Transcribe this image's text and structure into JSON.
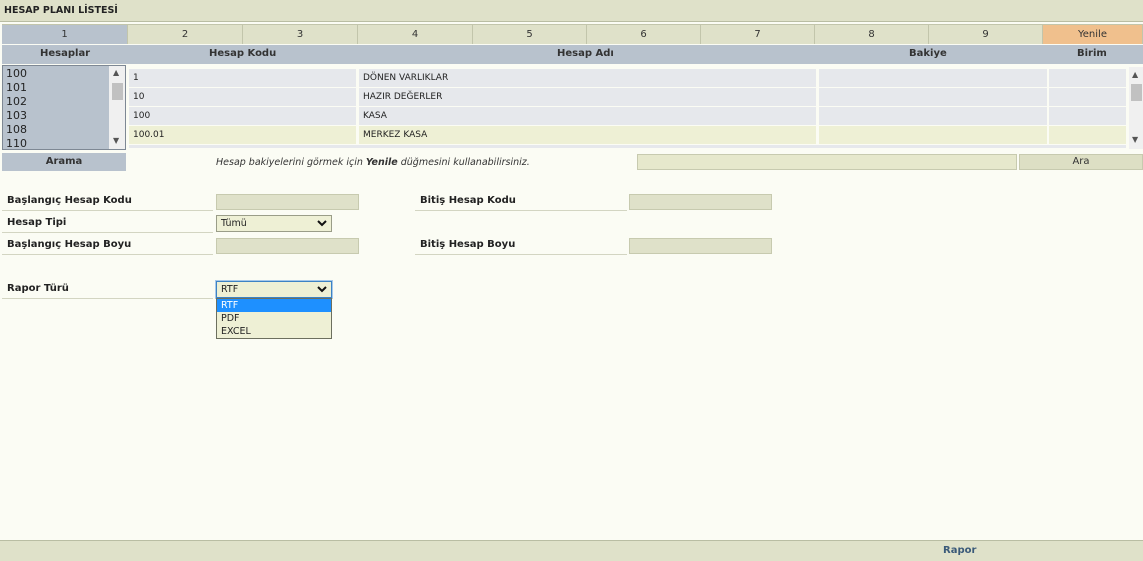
{
  "page": {
    "title": "HESAP PLANI LİSTESİ"
  },
  "tabs": [
    "1",
    "2",
    "3",
    "4",
    "5",
    "6",
    "7",
    "8",
    "9",
    "Yenile"
  ],
  "columns": {
    "hesaplar": "Hesaplar",
    "hesap_kodu": "Hesap Kodu",
    "hesap_adi": "Hesap Adı",
    "bakiye": "Bakiye",
    "birim": "Birim"
  },
  "account_list": [
    "100",
    "101",
    "102",
    "103",
    "108",
    "110"
  ],
  "rows": [
    {
      "code": "1",
      "name": "DÖNEN VARLIKLAR",
      "bakiye": "",
      "birim": ""
    },
    {
      "code": "10",
      "name": "HAZIR DEĞERLER",
      "bakiye": "",
      "birim": ""
    },
    {
      "code": "100",
      "name": "KASA",
      "bakiye": "",
      "birim": ""
    },
    {
      "code": "100.01",
      "name": "MERKEZ KASA",
      "bakiye": "",
      "birim": ""
    }
  ],
  "search": {
    "button": "Arama",
    "hint_pre": "Hesap bakiyelerini görmek için ",
    "hint_bold": "Yenile",
    "hint_post": " düğmesini kullanabilirsiniz.",
    "ara": "Ara",
    "value": ""
  },
  "form": {
    "baslangic_kodu": "Başlangıç Hesap Kodu",
    "bitis_kodu": "Bitiş Hesap Kodu",
    "hesap_tipi": "Hesap Tipi",
    "hesap_tipi_value": "Tümü",
    "baslangic_boyu": "Başlangıç Hesap Boyu",
    "bitis_boyu": "Bitiş Hesap Boyu",
    "rapor_turu": "Rapor Türü",
    "rapor_turu_value": "RTF",
    "rapor_options": [
      "RTF",
      "PDF",
      "EXCEL"
    ]
  },
  "footer": {
    "rapor": "Rapor"
  },
  "colors": {
    "header_bg": "#dfe1c9",
    "active_tab": "#b8c2cd",
    "yenile_tab": "#f0c08d",
    "row_a": "#e6e8ec",
    "row_highlight": "#eef0d5",
    "selected_option": "#1e90ff"
  }
}
